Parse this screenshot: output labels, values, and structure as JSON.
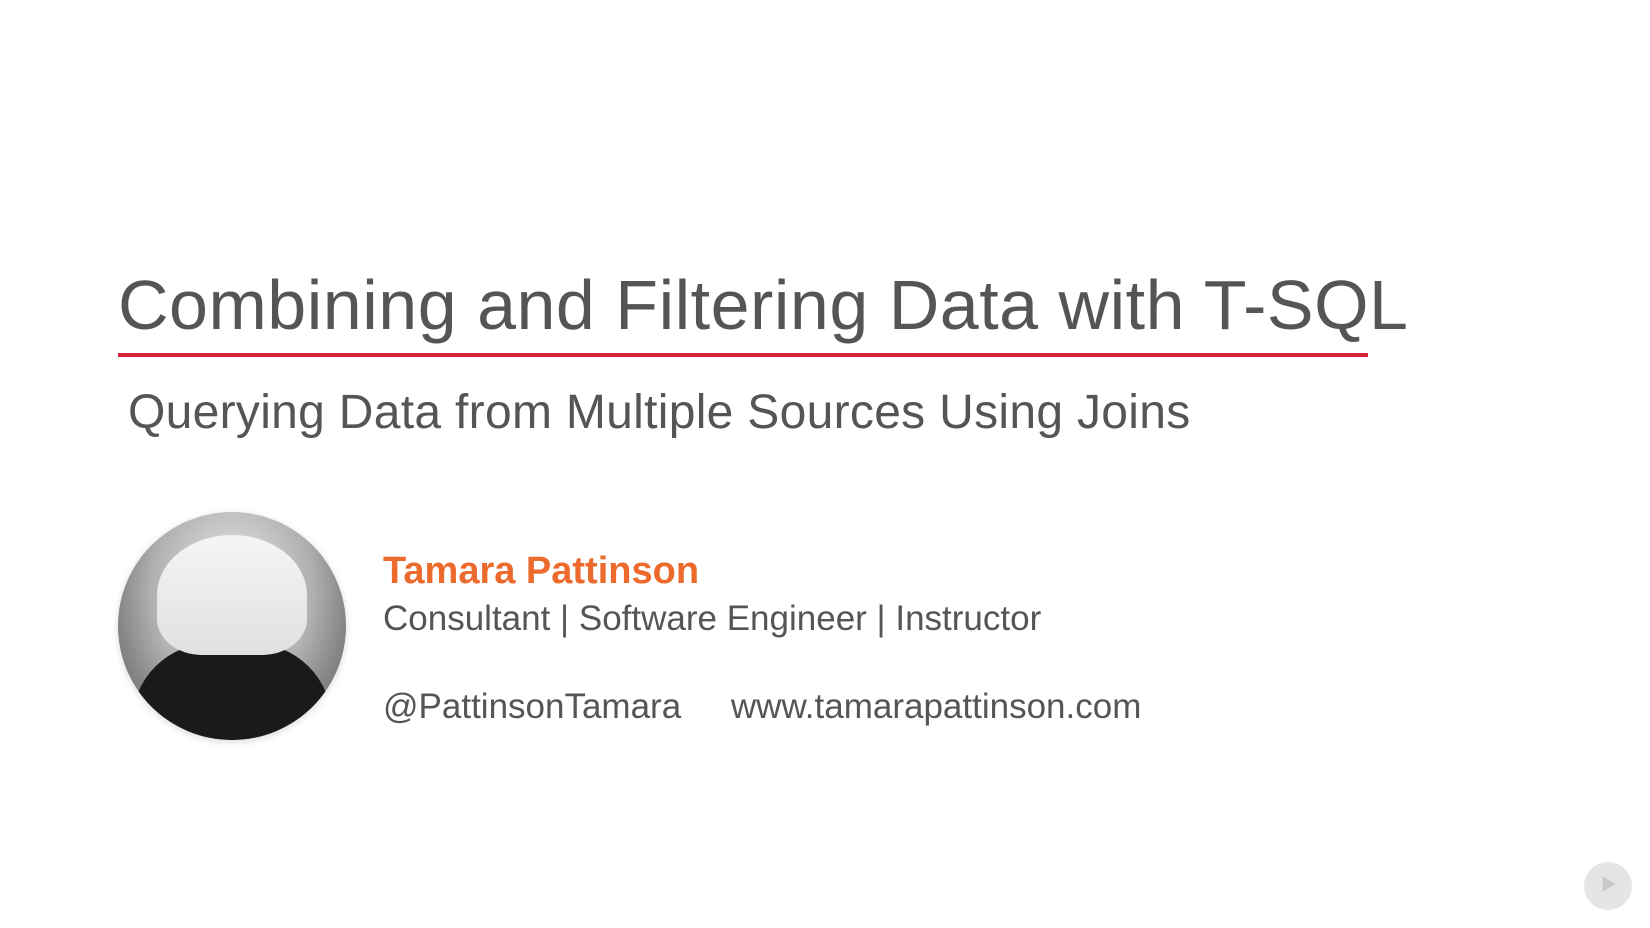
{
  "slide": {
    "title": "Combining and Filtering Data with T-SQL",
    "subtitle": "Querying Data from Multiple Sources Using Joins"
  },
  "author": {
    "name": "Tamara Pattinson",
    "role": "Consultant | Software Engineer | Instructor",
    "handle": "@PattinsonTamara",
    "website": "www.tamarapattinson.com"
  },
  "colors": {
    "accent_red": "#d6233c",
    "accent_orange": "#ec6a2c",
    "text_gray": "#555555"
  }
}
